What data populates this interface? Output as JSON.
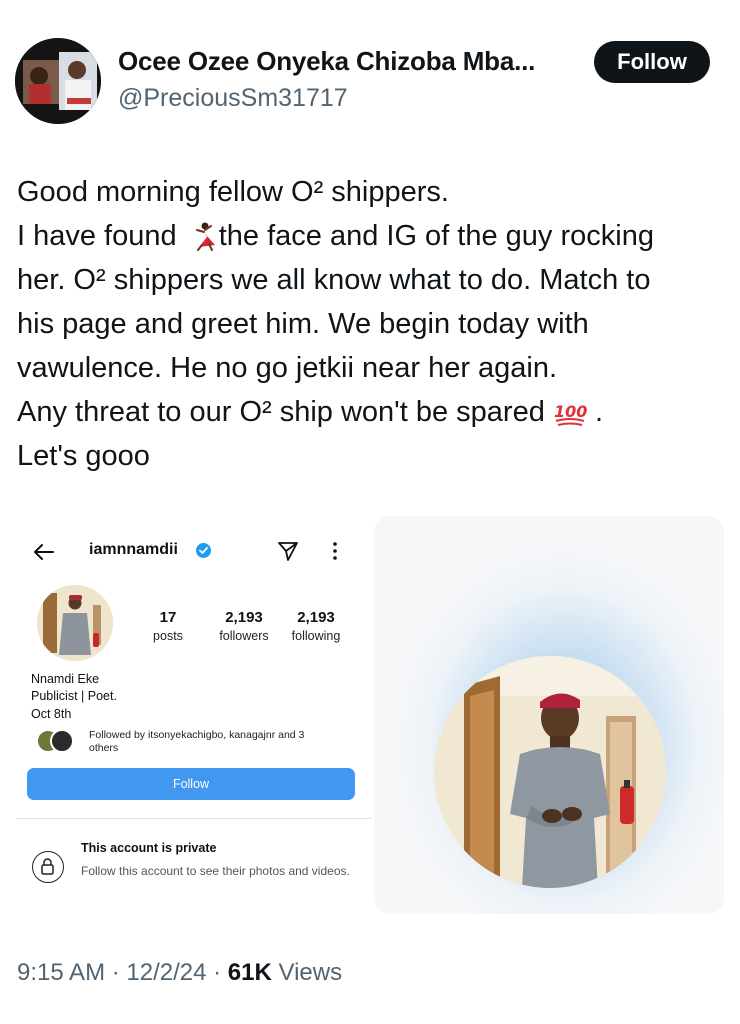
{
  "author": {
    "display_name": "Ocee Ozee Onyeka Chizoba Mba...",
    "handle": "@PreciousSm31717",
    "follow_label": "Follow"
  },
  "tweet": {
    "lines": [
      "Good morning fellow O² shippers.",
      "I have found",
      "the face and IG of the guy rocking",
      "her. O² shippers we all know what to do. Match to",
      "his page and greet him. We begin today with",
      "vawulence. He no go jetkii near her again.",
      "Any threat to our O² ship won't be spared",
      ".",
      "Let's gooo"
    ],
    "emojis": [
      "dancer-emoji",
      "hundred-points-emoji"
    ]
  },
  "instagram_card": {
    "username": "iamnnamdii",
    "stats": {
      "posts_count": "17",
      "posts_label": "posts",
      "followers_count": "2,193",
      "followers_label": "followers",
      "following_count": "2,193",
      "following_label": "following"
    },
    "name": "Nnamdi Eke",
    "bio": "Publicist | Poet.",
    "date": "Oct 8th",
    "followed_by": "Followed by itsonyekachigbo, kanagajnr and 3 others",
    "follow_label": "Follow",
    "private_title": "This account is private",
    "private_subtitle": "Follow this account to see their photos and videos."
  },
  "meta": {
    "time": "9:15 AM",
    "separator": " · ",
    "date": "12/2/24",
    "views_count": "61K",
    "views_label": " Views"
  },
  "colors": {
    "text": "#0f1419",
    "secondary": "#536471",
    "ig_blue": "#4297f0",
    "verified_blue": "#1d9bf0"
  }
}
